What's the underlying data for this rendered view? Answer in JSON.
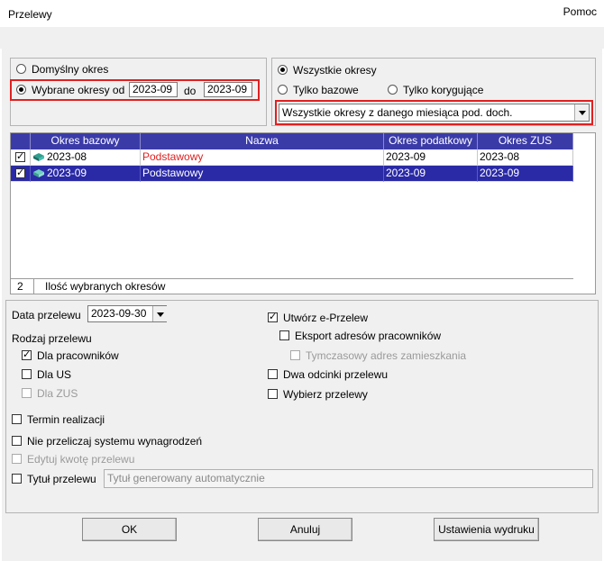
{
  "window": {
    "title": "Przelewy",
    "help": "Pomoc"
  },
  "periods": {
    "default_label": "Domyślny  okres",
    "selected_label": "Wybrane okresy od",
    "from": "2023-09",
    "to_label": "do",
    "to": "2023-09",
    "all_label": "Wszystkie okresy",
    "base_label": "Tylko bazowe",
    "corr_label": "Tylko korygujące",
    "combo_value": "Wszystkie okresy z danego miesiąca pod. doch."
  },
  "grid": {
    "headers": [
      "Okres bazowy",
      "Nazwa",
      "Okres podatkowy",
      "Okres ZUS"
    ],
    "rows": [
      {
        "base": "2023-08",
        "name": "Podstawowy",
        "tax": "2023-09",
        "zus": "2023-08"
      },
      {
        "base": "2023-09",
        "name": "Podstawowy",
        "tax": "2023-09",
        "zus": "2023-09"
      }
    ],
    "count": "2",
    "count_label": "Ilość wybranych okresów"
  },
  "transfer": {
    "date_label": "Data przelewu",
    "date_value": "2023-09-30",
    "type_label": "Rodzaj przelewu",
    "for_employees": "Dla pracowników",
    "for_us": "Dla US",
    "for_zus": "Dla ZUS",
    "deadline": "Termin realizacji",
    "no_recalc": "Nie przeliczaj systemu wynagrodzeń",
    "edit_amount": "Edytuj kwotę przelewu",
    "title_label": "Tytuł przelewu",
    "title_placeholder": "Tytuł generowany automatycznie",
    "create_e": "Utwórz e-Przelew",
    "export_addr": "Eksport adresów pracowników",
    "temp_addr": "Tymczasowy adres zamieszkania",
    "two_slips": "Dwa odcinki przelewu",
    "choose": "Wybierz przelewy"
  },
  "buttons": {
    "ok": "OK",
    "cancel": "Anuluj",
    "print": "Ustawienia wydruku"
  },
  "colors": {
    "accent": "#2a2aa6",
    "highlight": "#e02020"
  }
}
